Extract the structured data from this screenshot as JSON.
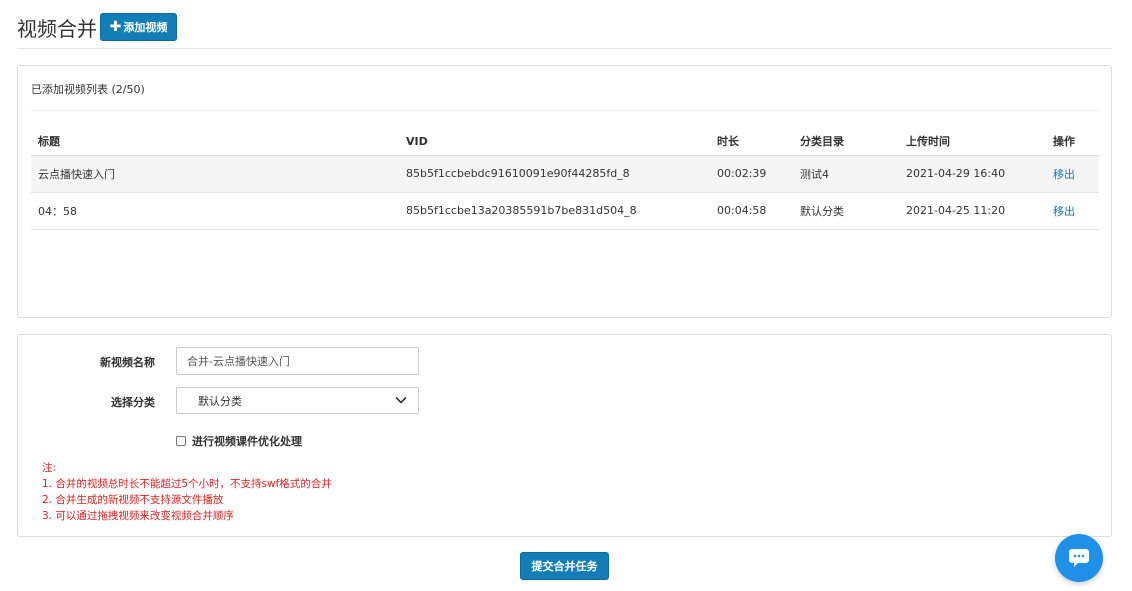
{
  "header": {
    "title": "视频合并",
    "add_button_icon": "plus-icon",
    "add_button_label": "添加视频"
  },
  "list": {
    "title": "已添加视频列表 (2/50)",
    "columns": [
      "标题",
      "VID",
      "时长",
      "分类目录",
      "上传时间",
      "操作"
    ],
    "rows": [
      {
        "title": "云点播快速入门",
        "vid": "85b5f1ccbebdc91610091e90f44285fd_8",
        "duration": "00:02:39",
        "category": "测试4",
        "uploaded": "2021-04-29 16:40",
        "action": "移出"
      },
      {
        "title": "04：58",
        "vid": "85b5f1ccbe13a20385591b7be831d504_8",
        "duration": "00:04:58",
        "category": "默认分类",
        "uploaded": "2021-04-25 11:20",
        "action": "移出"
      }
    ]
  },
  "form": {
    "name_label": "新视频名称",
    "name_value": "合并-云点播快速入门",
    "category_label": "选择分类",
    "category_value": "默认分类",
    "optimize_label": "进行视频课件优化处理",
    "optimize_checked": false,
    "notes": [
      "注:",
      "1. 合并的视频总时长不能超过5个小时，不支持swf格式的合并",
      "2. 合并生成的新视频不支持源文件播放",
      "3. 可以通过拖拽视频来改变视频合并顺序"
    ]
  },
  "submit_label": "提交合并任务",
  "colors": {
    "primary": "#137eb5",
    "note_red": "#e02020",
    "chat_blue": "#1e90e8"
  },
  "icons": {
    "chat": "chat-bubble-icon",
    "select": "chevron-down-icon"
  }
}
